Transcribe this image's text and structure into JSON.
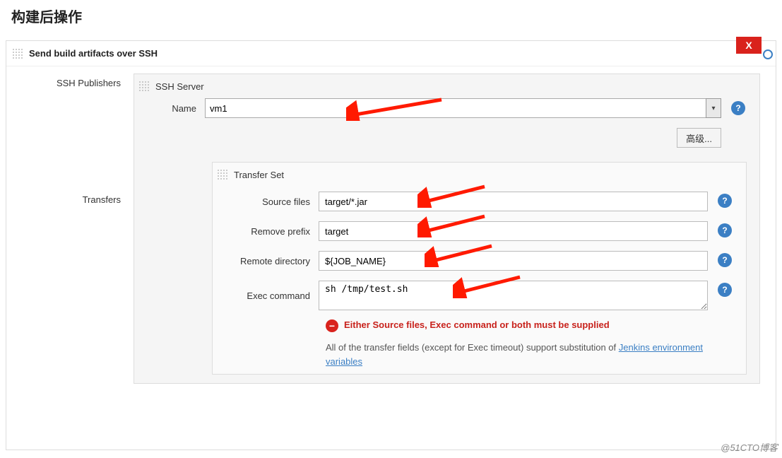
{
  "page": {
    "title": "构建后操作"
  },
  "section": {
    "title": "Send build artifacts over SSH",
    "close_label": "X"
  },
  "left": {
    "publishers_label": "SSH Publishers",
    "transfers_label": "Transfers"
  },
  "server": {
    "heading": "SSH Server",
    "name_label": "Name",
    "name_value": "vm1",
    "advanced_label": "高级..."
  },
  "transfer": {
    "heading": "Transfer Set",
    "source_label": "Source files",
    "source_value": "target/*.jar",
    "remove_prefix_label": "Remove prefix",
    "remove_prefix_value": "target",
    "remote_dir_label": "Remote directory",
    "remote_dir_value": "${JOB_NAME}",
    "exec_label": "Exec command",
    "exec_value": "sh /tmp/test.sh",
    "error_text": "Either Source files, Exec command or both must be supplied",
    "hint_pre": "All of the transfer fields (except for Exec timeout) support substitution of ",
    "hint_link": "Jenkins environment variables"
  },
  "watermark": "@51CTO博客"
}
